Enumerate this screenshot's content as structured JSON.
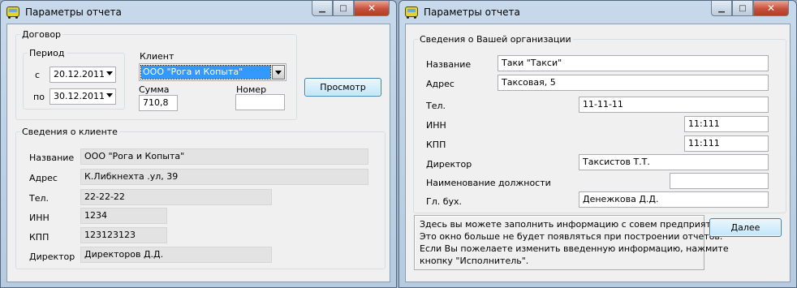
{
  "window_left": {
    "title": "Параметры отчета",
    "contract": {
      "group_label": "Договор",
      "period_label": "Период",
      "from_label": "с",
      "from_date": "20.12.2011",
      "to_label": "по",
      "to_date": "30.12.2011",
      "client_label": "Клиент",
      "client_value": "ООО \"Рога и Копыта\"",
      "sum_label": "Сумма",
      "sum_value": "710,8",
      "number_label": "Номер",
      "number_value": ""
    },
    "preview_button": "Просмотр",
    "client_info": {
      "group_label": "Сведения о клиенте",
      "fields": [
        {
          "label": "Название",
          "value": "ООО \"Рога и Копыта\""
        },
        {
          "label": "Адрес",
          "value": "К.Либкнехта .ул, 39"
        },
        {
          "label": "Тел.",
          "value": "22-22-22"
        },
        {
          "label": "ИНН",
          "value": "1234"
        },
        {
          "label": "КПП",
          "value": "123123123"
        },
        {
          "label": "Директор",
          "value": "Директоров Д.Д."
        }
      ]
    }
  },
  "window_right": {
    "title": "Параметры отчета",
    "org": {
      "group_label": "Сведения о Вашей организации",
      "fields": [
        {
          "label": "Название",
          "value": "Таки \"Такси\""
        },
        {
          "label": "Адрес",
          "value": "Таксовая, 5"
        },
        {
          "label": "Тел.",
          "value": "11-11-11"
        },
        {
          "label": "ИНН",
          "value": "11:111"
        },
        {
          "label": "КПП",
          "value": "11:111"
        },
        {
          "label": "Директор",
          "value": "Таксистов Т.Т."
        },
        {
          "label": "Наименование должности",
          "value": ""
        },
        {
          "label": "Гл. бух.",
          "value": "Денежкова Д.Д."
        }
      ]
    },
    "info_lines": [
      "Здесь вы можете заполнить информацию с совем предприятии.",
      "Это окно больше не будет появляться при построении отчетов.",
      "Если Вы пожелаете изменить введенную информацию, нажмите",
      "кнопку \"Исполнитель\"."
    ],
    "next_button": "Далее"
  },
  "window_controls": {
    "minimize": "▁",
    "maximize": "□",
    "close": "✕"
  },
  "colors": {
    "selection": "#3399ff",
    "readonly_field": "#e3e3e3",
    "button_border": "#3c7fb1"
  }
}
